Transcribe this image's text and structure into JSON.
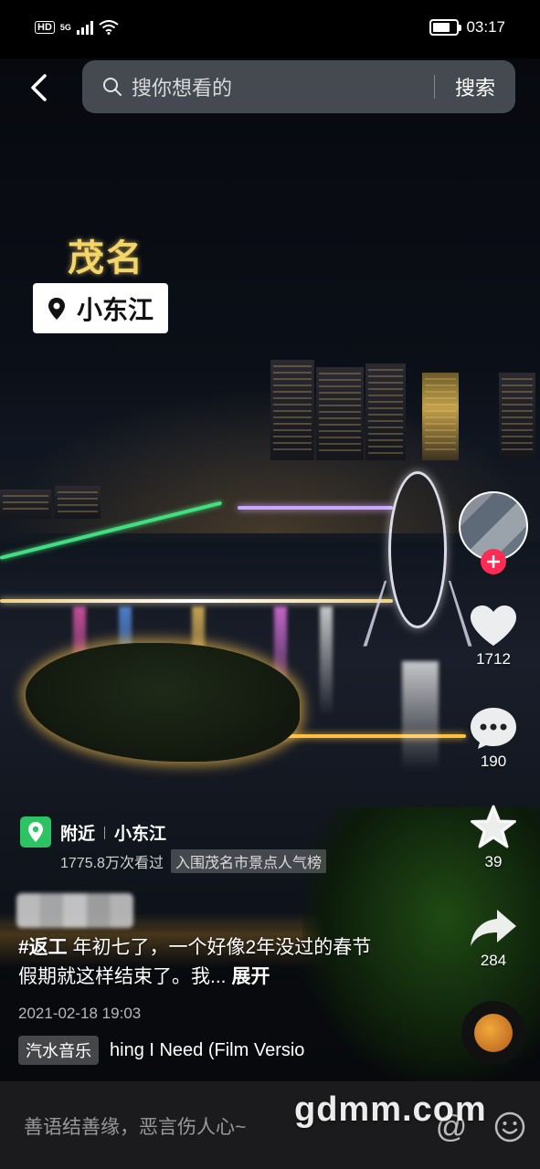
{
  "status_bar": {
    "hd": "HD",
    "network": "5G",
    "time": "03:17",
    "battery_level": 0.75
  },
  "search": {
    "placeholder": "搜你想看的",
    "button_label": "搜索"
  },
  "overlay": {
    "city_title": "茂名",
    "location_tag": "小东江"
  },
  "poi": {
    "prefix": "附近",
    "name": "小东江",
    "views": "1775.8万次看过",
    "rank_badge": "入围茂名市景点人气榜"
  },
  "post": {
    "hashtag": "#返工",
    "caption": " 年初七了，一个好像2年没过的春节假期就这样结束了。我...",
    "expand_label": "展开",
    "date": "2021-02-18 19:03"
  },
  "music": {
    "tag": "汽水音乐",
    "title": "hing I Need (Film Versio"
  },
  "actions": {
    "likes": "1712",
    "comments": "190",
    "favorites": "39",
    "shares": "284"
  },
  "comment_bar": {
    "placeholder": "善语结善缘，恶言伤人心~"
  },
  "watermark": "gdmm.com",
  "colors": {
    "like_red": "#fe2c55",
    "poi_green": "#2cc463",
    "title_gold": "#f5d56a"
  }
}
